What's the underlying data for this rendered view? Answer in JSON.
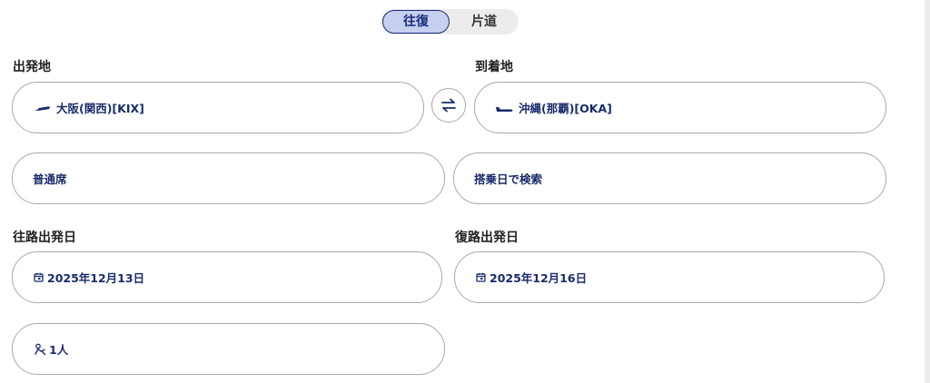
{
  "trip_type": {
    "round_trip": "往復",
    "one_way": "片道",
    "selected": "往復"
  },
  "departure": {
    "label": "出発地",
    "value": "大阪(関西)[KIX]",
    "icon": "plane-takeoff-icon"
  },
  "arrival": {
    "label": "到着地",
    "value": "沖縄(那覇)[OKA]",
    "icon": "plane-landing-icon"
  },
  "swap": {
    "icon": "swap-arrows-icon"
  },
  "cabin": {
    "value": "普通席"
  },
  "search_mode": {
    "value": "搭乗日で検索"
  },
  "outbound": {
    "label": "往路出発日",
    "value": "2025年12月13日",
    "icon": "calendar-icon"
  },
  "return": {
    "label": "復路出発日",
    "value": "2025年12月16日",
    "icon": "calendar-icon"
  },
  "passengers": {
    "value": "1人",
    "icon": "passenger-icon"
  },
  "colors": {
    "accent": "#1a2b7a",
    "toggle_active_bg": "#c6cff0",
    "border": "#a9a9a9",
    "text_value": "#1a2b6b"
  }
}
